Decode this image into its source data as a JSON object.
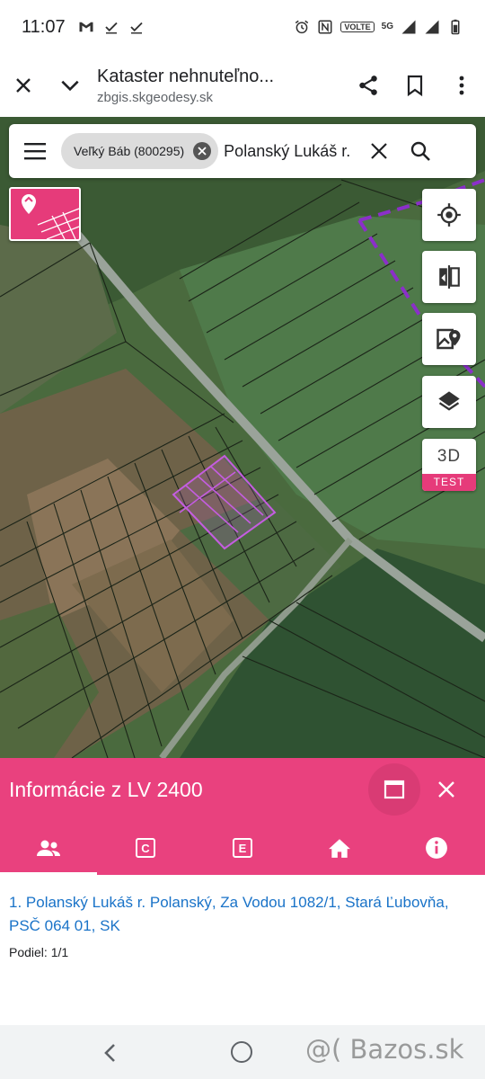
{
  "status_bar": {
    "time": "11:07",
    "left_icons": [
      "gmail-icon",
      "download-done-icon",
      "download-done-icon"
    ],
    "right_icons": [
      "alarm-icon",
      "nfc-icon",
      "volte-badge",
      "5g-icon",
      "signal-icon",
      "signal-icon",
      "battery-icon"
    ],
    "volte": "VOLTE",
    "network": "5G"
  },
  "browser": {
    "title": "Kataster nehnuteľno...",
    "url": "zbgis.skgeodesy.sk",
    "icons": [
      "close-icon",
      "chevron-down-icon",
      "share-icon",
      "bookmark-icon",
      "more-vert-icon"
    ]
  },
  "search": {
    "chip_label": "Veľký Báb (800295)",
    "query": "Polanský Lukáš r."
  },
  "map_controls": {
    "three_d": "3D",
    "test": "TEST",
    "accent": "#e9417e",
    "highlight": "#c45de0"
  },
  "info_panel": {
    "title": "Informácie z LV 2400",
    "tabs": [
      {
        "icon": "people-icon"
      },
      {
        "icon": "c-box-icon",
        "letter": "C"
      },
      {
        "icon": "e-box-icon",
        "letter": "E"
      },
      {
        "icon": "home-icon"
      },
      {
        "icon": "info-icon"
      }
    ],
    "owner_line": "1. Polanský Lukáš r. Polanský, Za Vodou 1082/1, Stará Ľubovňa, PSČ 064 01, SK",
    "share": "Podiel: 1/1"
  },
  "watermark": "@( Bazos.sk"
}
